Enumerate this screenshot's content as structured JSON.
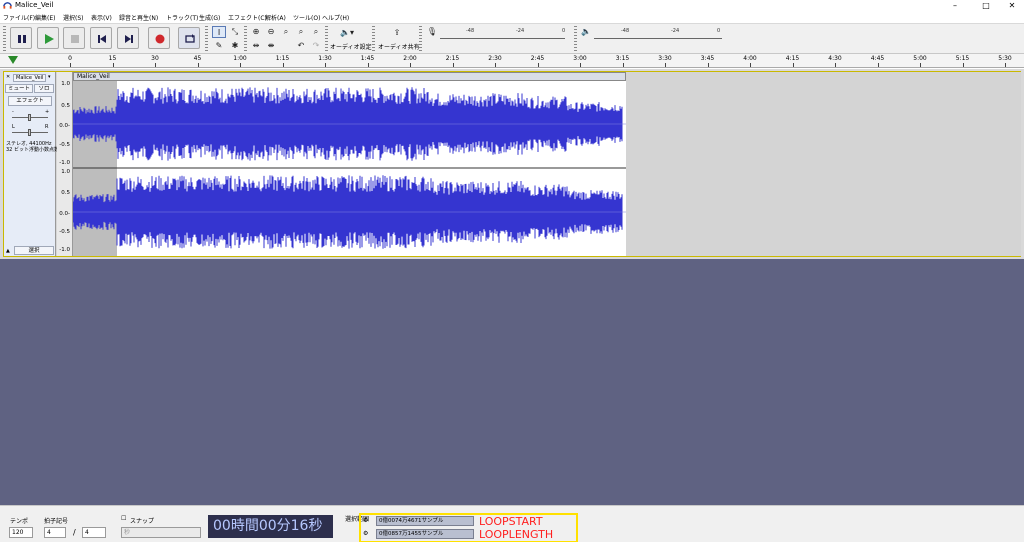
{
  "window": {
    "title": "Malice_Veil",
    "controls": [
      "–",
      "□",
      "✕"
    ]
  },
  "menu": [
    "ファイル(F)",
    "編集(E)",
    "選択(S)",
    "表示(V)",
    "録音と再生(N)",
    "トラック(T)",
    "生成(G)",
    "エフェクト(C)",
    "解析(A)",
    "ツール(O)",
    "ヘルプ(H)"
  ],
  "toolbar": {
    "transport": [
      "pause-icon",
      "play-icon",
      "stop-icon",
      "skip-start-icon",
      "skip-end-icon",
      "record-icon",
      "loop-icon"
    ],
    "audio_setup_label": "オーディオ設定",
    "audio_share_label": "オーディオ共有",
    "meter_scale": [
      "-48",
      "-24",
      "0"
    ],
    "colors": {
      "record": "#d0282c",
      "play": "#2e9a3a",
      "transport_icon": "#1f1f4e"
    }
  },
  "ruler": {
    "labels": [
      "0",
      "15",
      "30",
      "45",
      "1:00",
      "1:15",
      "1:30",
      "1:45",
      "2:00",
      "2:15",
      "2:30",
      "2:45",
      "3:00",
      "3:15",
      "3:30",
      "3:45",
      "4:00",
      "4:15",
      "4:30",
      "4:45",
      "5:00",
      "5:15",
      "5:30"
    ]
  },
  "track": {
    "name": "Malice_Veil",
    "mute_label": "ミュート",
    "solo_label": "ソロ",
    "effects_label": "エフェクト",
    "gain_minus": "-",
    "gain_plus": "+",
    "pan_left": "L",
    "pan_right": "R",
    "info_line1": "ステレオ, 44100Hz",
    "info_line2": "32 ビット浮動小数点数",
    "select_label": "選択",
    "scale_top": [
      "1.0",
      "0.5",
      "0.0-",
      "-0.5",
      "-1.0"
    ],
    "scale_bottom": [
      "1.0",
      "0.5",
      "0.0-",
      "-0.5",
      "-1.0"
    ],
    "waveform_color": "#3535d0"
  },
  "bottom": {
    "tempo_label": "テンポ",
    "tempo_value": "120",
    "time_sig_label": "拍子記号",
    "time_sig_num": "4",
    "time_sig_den": "4",
    "snap_label": "スナップ",
    "snap_value": "秒",
    "time_display": "00時間00分16秒",
    "selection_label": "選択範囲",
    "loopstart_value": "0億0074万4671サンプル",
    "looplength_value": "0億0857万1455サンプル",
    "loopstart_annotation": "LOOPSTART",
    "looplength_annotation": "LOOPLENGTH",
    "highlight_color": "#ffe100"
  }
}
